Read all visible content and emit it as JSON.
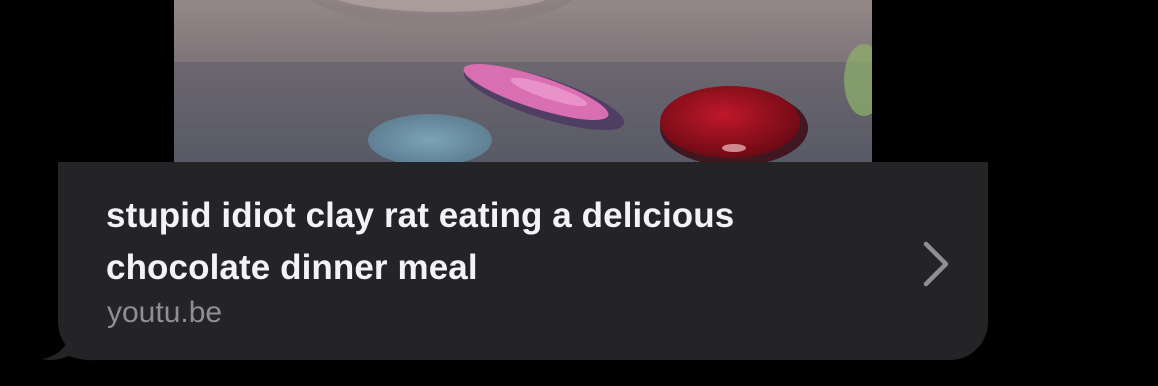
{
  "link_preview": {
    "title": "stupid idiot clay rat eating a delicious chocolate dinner meal",
    "domain": "youtu.be",
    "open_icon": "chevron-right-icon",
    "thumbnail_icon": "video-thumbnail"
  },
  "colors": {
    "background": "#000000",
    "bubble": "#242427",
    "title_text": "#f2f2f7",
    "domain_text": "#8e8e93",
    "chevron": "#8e8e93"
  }
}
